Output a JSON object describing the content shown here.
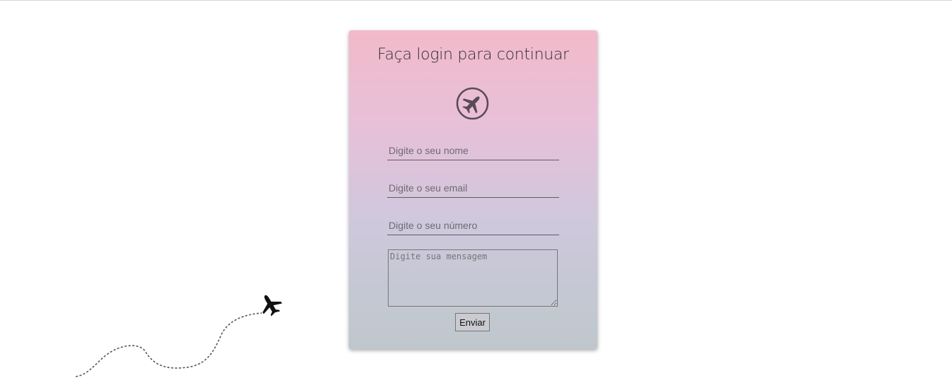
{
  "form": {
    "title": "Faça login para continuar",
    "logo_icon": "airplane-circle-icon",
    "name_placeholder": "Digite o seu nome",
    "email_placeholder": "Digite o seu email",
    "phone_placeholder": "Digite o seu número",
    "message_placeholder": "Digite sua mensagem",
    "submit_label": "Enviar"
  },
  "decoration": {
    "icon": "airplane-icon",
    "path": "dashed-flight-path"
  },
  "colors": {
    "gradient_top": "#f2bac9",
    "gradient_mid": "#cfc8dd",
    "gradient_bottom": "#c0c7cc",
    "text": "#2f2f35"
  }
}
